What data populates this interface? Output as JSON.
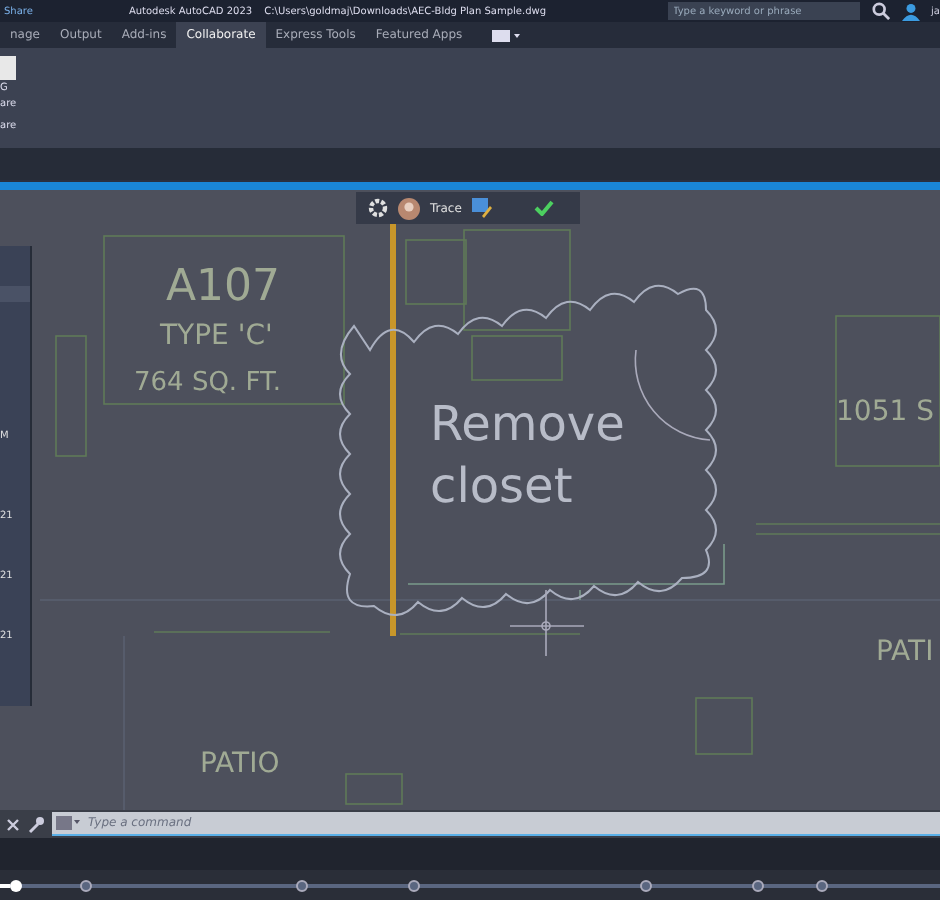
{
  "title_bar": {
    "share": "Share",
    "app_title": "Autodesk AutoCAD 2023",
    "file_path": "C:\\Users\\goldmaj\\Downloads\\AEC-Bldg Plan Sample.dwg",
    "search": {
      "placeholder": "Type a keyword or phrase"
    },
    "user": "ja"
  },
  "ribbon_tabs": [
    {
      "label": "nage",
      "selected": false
    },
    {
      "label": "Output",
      "selected": false
    },
    {
      "label": "Add-ins",
      "selected": false
    },
    {
      "label": "Collaborate",
      "selected": true
    },
    {
      "label": "Express Tools",
      "selected": false
    },
    {
      "label": "Featured Apps",
      "selected": false
    }
  ],
  "ribbon_panel": {
    "lines": [
      "G",
      "are"
    ],
    "panel_label": "are"
  },
  "trace_toolbar": {
    "label": "Trace"
  },
  "side_panel": {
    "items": [
      "M",
      "21",
      "21",
      "21"
    ]
  },
  "drawing": {
    "labels": [
      {
        "text": "A107",
        "kind": "room"
      },
      {
        "text": "TYPE 'C'",
        "kind": "room"
      },
      {
        "text": "764 SQ. FT.",
        "kind": "room"
      },
      {
        "text": "1051 S",
        "kind": "room"
      },
      {
        "text": "PATIO",
        "kind": "room"
      },
      {
        "text": "PATI",
        "kind": "room"
      }
    ],
    "markup": [
      "Remove",
      "closet"
    ]
  },
  "command_line": {
    "placeholder": "Type a command"
  },
  "video_timeline": {
    "level": 0.01
  }
}
